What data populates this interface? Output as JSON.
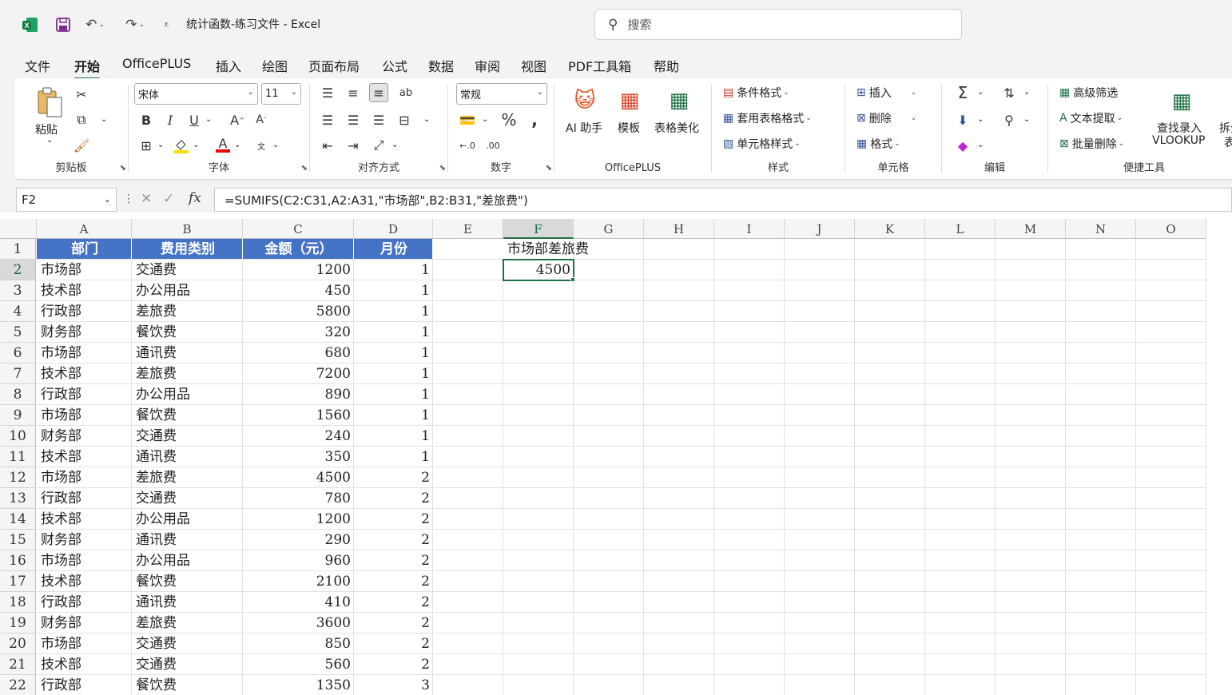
{
  "titlebar": {
    "doc_title": "统计函数-练习文件  -  Excel",
    "search_placeholder": "搜索",
    "icons": [
      "excel-logo-icon",
      "save-icon",
      "undo-icon",
      "redo-icon",
      "customize-qat-icon"
    ]
  },
  "menu": [
    "文件",
    "开始",
    "OfficePLUS",
    "插入",
    "绘图",
    "页面布局",
    "公式",
    "数据",
    "审阅",
    "视图",
    "PDF工具箱",
    "帮助"
  ],
  "active_menu": "开始",
  "ribbon": {
    "clipboard": {
      "label": "剪贴板",
      "paste": "粘贴"
    },
    "font": {
      "label": "字体",
      "font_name": "宋体",
      "font_size": "11"
    },
    "alignment": {
      "label": "对齐方式"
    },
    "number": {
      "label": "数字",
      "format": "常规"
    },
    "officeplus": {
      "label": "OfficePLUS",
      "ai": "AI 助手",
      "template": "模板",
      "beautify": "表格美化"
    },
    "styles": {
      "label": "样式",
      "conditional": "条件格式",
      "table_format": "套用表格格式",
      "cell_styles": "单元格样式"
    },
    "cells": {
      "label": "单元格",
      "insert": "插入",
      "delete": "删除",
      "format": "格式"
    },
    "editing": {
      "label": "编辑"
    },
    "quick_tools": {
      "label": "便捷工具",
      "advanced_filter": "高级筛选",
      "text_extract": "文本提取",
      "batch_delete": "批量删除",
      "lookup": "查找录入",
      "vlookup": "VLOOKUP",
      "split": "拆分",
      "split2": "表"
    }
  },
  "formula_bar": {
    "name_box": "F2",
    "fx": "fx",
    "formula": "=SUMIFS(C2:C31,A2:A31,\"市场部\",B2:B31,\"差旅费\")"
  },
  "sheet": {
    "columns": [
      "A",
      "B",
      "C",
      "D",
      "E",
      "F",
      "G",
      "H",
      "I",
      "J",
      "K",
      "L",
      "M",
      "N",
      "O"
    ],
    "header_row": [
      "部门",
      "费用类别",
      "金额（元）",
      "月份"
    ],
    "rows": [
      [
        "市场部",
        "交通费",
        "1200",
        "1"
      ],
      [
        "技术部",
        "办公用品",
        "450",
        "1"
      ],
      [
        "行政部",
        "差旅费",
        "5800",
        "1"
      ],
      [
        "财务部",
        "餐饮费",
        "320",
        "1"
      ],
      [
        "市场部",
        "通讯费",
        "680",
        "1"
      ],
      [
        "技术部",
        "差旅费",
        "7200",
        "1"
      ],
      [
        "行政部",
        "办公用品",
        "890",
        "1"
      ],
      [
        "市场部",
        "餐饮费",
        "1560",
        "1"
      ],
      [
        "财务部",
        "交通费",
        "240",
        "1"
      ],
      [
        "技术部",
        "通讯费",
        "350",
        "1"
      ],
      [
        "市场部",
        "差旅费",
        "4500",
        "2"
      ],
      [
        "行政部",
        "交通费",
        "780",
        "2"
      ],
      [
        "技术部",
        "办公用品",
        "1200",
        "2"
      ],
      [
        "财务部",
        "通讯费",
        "290",
        "2"
      ],
      [
        "市场部",
        "办公用品",
        "960",
        "2"
      ],
      [
        "技术部",
        "餐饮费",
        "2100",
        "2"
      ],
      [
        "行政部",
        "通讯费",
        "410",
        "2"
      ],
      [
        "财务部",
        "差旅费",
        "3600",
        "2"
      ],
      [
        "市场部",
        "交通费",
        "850",
        "2"
      ],
      [
        "技术部",
        "交通费",
        "560",
        "2"
      ],
      [
        "行政部",
        "餐饮费",
        "1350",
        "3"
      ]
    ],
    "f1_label": "市场部差旅费",
    "f2_value": "4500",
    "row_numbers": [
      "1",
      "2",
      "3",
      "4",
      "5",
      "6",
      "7",
      "8",
      "9",
      "10",
      "11",
      "12",
      "13",
      "14",
      "15",
      "16",
      "17",
      "18",
      "19",
      "20",
      "21",
      "22"
    ],
    "selected_cell": "F2",
    "header_fill": "#4472c4",
    "accent": "#1e7145"
  }
}
